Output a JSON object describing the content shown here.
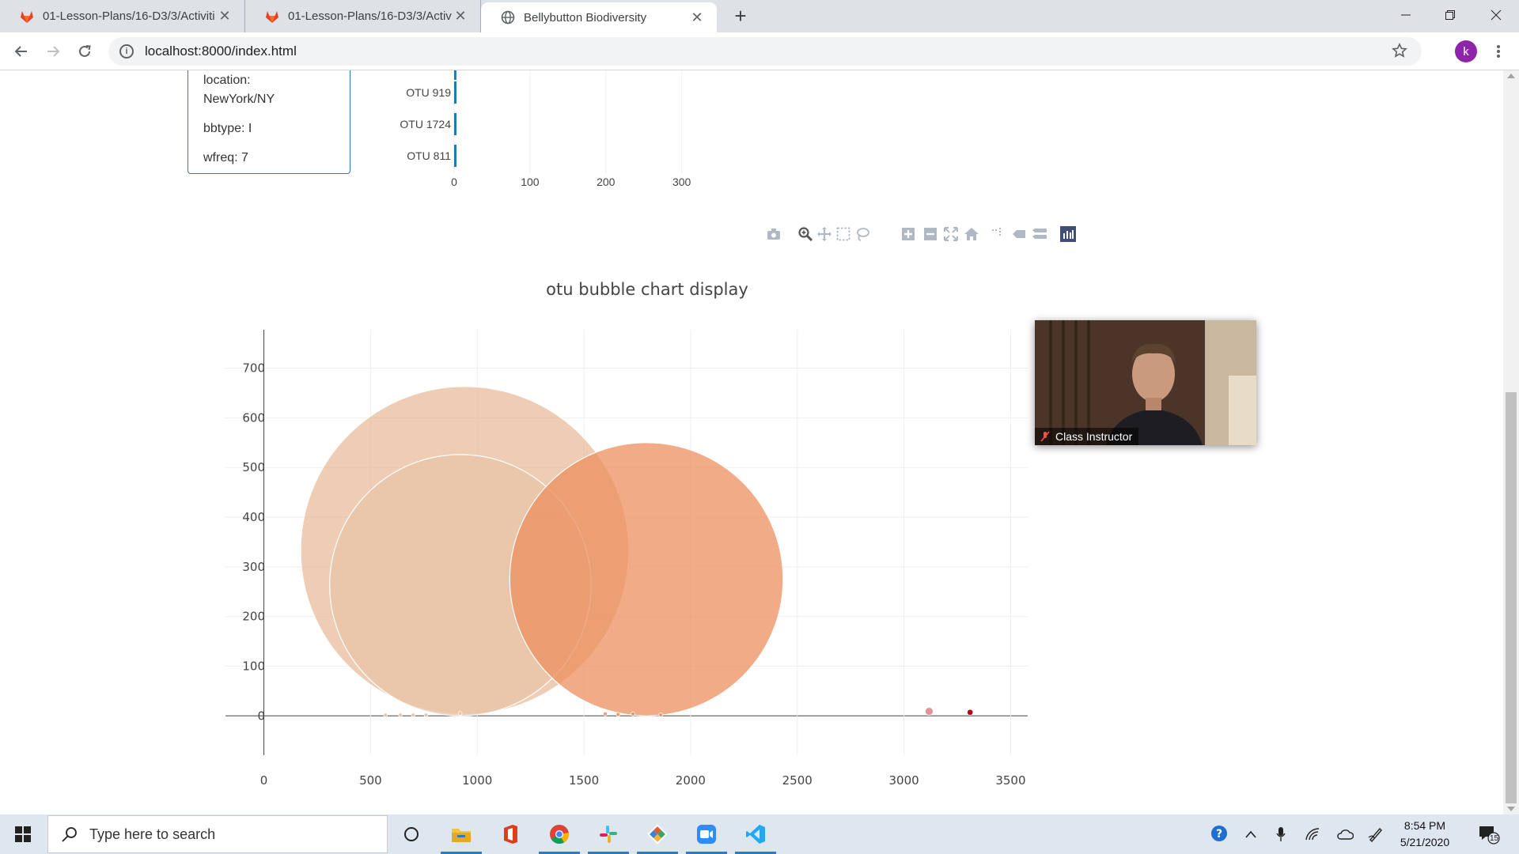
{
  "browser": {
    "tabs": [
      {
        "label": "01-Lesson-Plans/16-D3/3/Activiti",
        "icon": "gitlab-icon",
        "active": false
      },
      {
        "label": "01-Lesson-Plans/16-D3/3/Activiti",
        "icon": "gitlab-icon",
        "active": false
      },
      {
        "label": "Bellybutton Biodiversity",
        "icon": "globe-icon",
        "active": true
      }
    ],
    "url": "localhost:8000/index.html",
    "profile_initial": "k"
  },
  "metadata_panel": {
    "location_label": "location:",
    "location_value": "NewYork/NY",
    "bbtype": "bbtype: I",
    "wfreq": "wfreq: 7"
  },
  "bar_chart": {
    "type": "bar",
    "orientation": "horizontal",
    "categories": [
      "OTU 919",
      "OTU 1724",
      "OTU 811"
    ],
    "values": [
      3,
      3,
      3
    ],
    "x_ticks": [
      "0",
      "100",
      "200",
      "300"
    ],
    "xlim": [
      0,
      340
    ],
    "bar_color": "#1f77b4"
  },
  "modebar": {
    "buttons": [
      "camera-icon",
      "zoom-icon",
      "pan-icon",
      "box-select-icon",
      "lasso-select-icon",
      "zoom-in-icon",
      "zoom-out-icon",
      "autoscale-icon",
      "reset-axes-icon",
      "spike-lines-icon",
      "hover-closest-icon",
      "hover-compare-icon",
      "plotly-logo-icon"
    ]
  },
  "chart_data": {
    "type": "scatter",
    "title": "otu bubble chart display",
    "xlim": [
      -180,
      3580
    ],
    "ylim": [
      -60,
      790
    ],
    "x_ticks": [
      "0",
      "500",
      "1000",
      "1500",
      "2000",
      "2500",
      "3000",
      "3500"
    ],
    "y_ticks": [
      "0",
      "100",
      "200",
      "300",
      "400",
      "500",
      "600",
      "700"
    ],
    "grid": true,
    "points": [
      {
        "x": 941,
        "y": 333,
        "size_y": 330,
        "color": "#e8b896",
        "opacity": 0.7
      },
      {
        "x": 921,
        "y": 263,
        "size_y": 263,
        "color": "#e8c3a8",
        "opacity": 0.75
      },
      {
        "x": 1793,
        "y": 275,
        "size_y": 275,
        "color": "#ec8f5f",
        "opacity": 0.75
      },
      {
        "x": 3118,
        "y": 9,
        "size_y": 8,
        "color": "#d98a8f",
        "opacity": 0.9
      },
      {
        "x": 3310,
        "y": 7,
        "size_y": 6,
        "color": "#b5001f",
        "opacity": 1
      },
      {
        "x": 570,
        "y": 2,
        "size_y": 3,
        "color": "#e8c3a8",
        "opacity": 0.9
      },
      {
        "x": 640,
        "y": 2,
        "size_y": 3,
        "color": "#e8c3a8",
        "opacity": 0.9
      },
      {
        "x": 700,
        "y": 2,
        "size_y": 3,
        "color": "#e8c3a8",
        "opacity": 0.9
      },
      {
        "x": 760,
        "y": 2,
        "size_y": 3,
        "color": "#e8c3a8",
        "opacity": 0.9
      },
      {
        "x": 920,
        "y": 5,
        "size_y": 4,
        "color": "#e8c3a8",
        "opacity": 0.9
      },
      {
        "x": 1600,
        "y": 4,
        "size_y": 3,
        "color": "#ec8f5f",
        "opacity": 0.9
      },
      {
        "x": 1660,
        "y": 3,
        "size_y": 3,
        "color": "#ec8f5f",
        "opacity": 0.9
      },
      {
        "x": 1730,
        "y": 4,
        "size_y": 3,
        "color": "#ec8f5f",
        "opacity": 0.9
      },
      {
        "x": 1860,
        "y": 2,
        "size_y": 3,
        "color": "#ec8f5f",
        "opacity": 0.9
      }
    ]
  },
  "video": {
    "label": "Class Instructor"
  },
  "taskbar": {
    "search_placeholder": "Type here to search",
    "apps": [
      "task-view-icon",
      "file-explorer-icon",
      "office-icon",
      "chrome-icon",
      "slack-icon",
      "git-icon",
      "zoom-app-icon",
      "vscode-icon"
    ],
    "time": "8:54 PM",
    "date": "5/21/2020",
    "notification_count": "15"
  }
}
